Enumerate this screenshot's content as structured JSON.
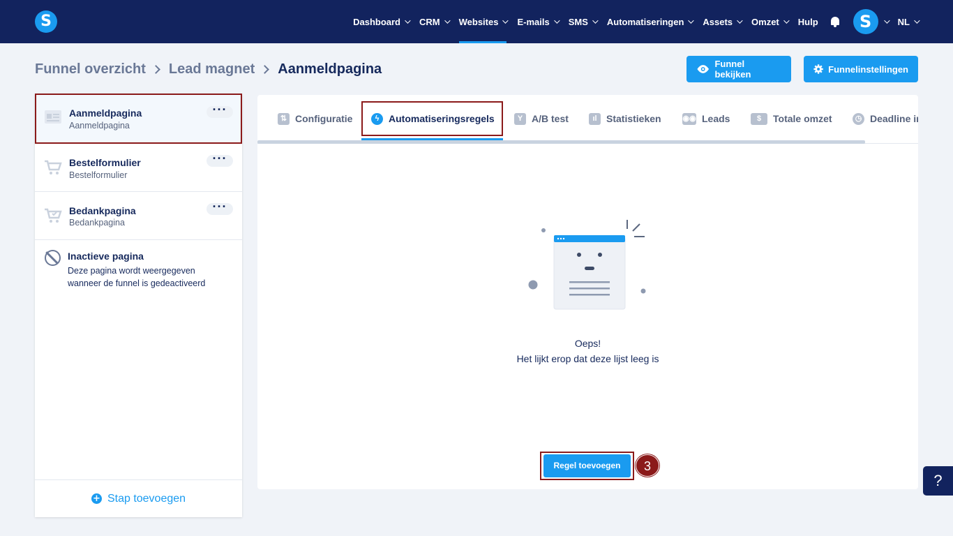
{
  "brand": {
    "logo_letter": "S"
  },
  "nav": {
    "items": [
      {
        "label": "Dashboard",
        "has_dropdown": true
      },
      {
        "label": "CRM",
        "has_dropdown": true
      },
      {
        "label": "Websites",
        "has_dropdown": true,
        "active": true
      },
      {
        "label": "E-mails",
        "has_dropdown": true
      },
      {
        "label": "SMS",
        "has_dropdown": true
      },
      {
        "label": "Automatiseringen",
        "has_dropdown": true
      },
      {
        "label": "Assets",
        "has_dropdown": true
      },
      {
        "label": "Omzet",
        "has_dropdown": true
      },
      {
        "label": "Hulp",
        "has_dropdown": false
      }
    ],
    "avatar_letter": "S",
    "language": "NL"
  },
  "breadcrumb": {
    "items": [
      "Funnel overzicht",
      "Lead magnet",
      "Aanmeldpagina"
    ]
  },
  "actions": {
    "view_funnel": "Funnel bekijken",
    "funnel_settings": "Funnelinstellingen"
  },
  "sidebar": {
    "steps": [
      {
        "title": "Aanmeldpagina",
        "subtitle": "Aanmeldpagina",
        "icon": "form-page-icon",
        "selected": true
      },
      {
        "title": "Bestelformulier",
        "subtitle": "Bestelformulier",
        "icon": "cart-icon"
      },
      {
        "title": "Bedankpagina",
        "subtitle": "Bedankpagina",
        "icon": "cart-check-icon"
      }
    ],
    "inactive": {
      "title": "Inactieve pagina",
      "description": "Deze pagina wordt weergegeven wanneer de funnel is gedeactiveerd"
    },
    "add_step": "Stap toevoegen"
  },
  "tabs": [
    {
      "label": "Configuratie",
      "icon": "sliders-icon"
    },
    {
      "label": "Automatiseringsregels",
      "icon": "bolt-icon",
      "active": true
    },
    {
      "label": "A/B test",
      "icon": "split-icon"
    },
    {
      "label": "Statistieken",
      "icon": "bar-chart-icon"
    },
    {
      "label": "Leads",
      "icon": "people-icon"
    },
    {
      "label": "Totale omzet",
      "icon": "dollar-icon"
    },
    {
      "label": "Deadline ir",
      "icon": "clock-icon"
    }
  ],
  "empty_state": {
    "title": "Oeps!",
    "description": "Het lijkt erop dat deze lijst leeg is"
  },
  "add_rule_button": "Regel toevoegen",
  "step_marker": "3",
  "help_label": "?",
  "colors": {
    "navbar": "#12235e",
    "accent": "#1a9bf0",
    "highlight_border": "#8b1a1a",
    "background": "#f0f3f8"
  }
}
